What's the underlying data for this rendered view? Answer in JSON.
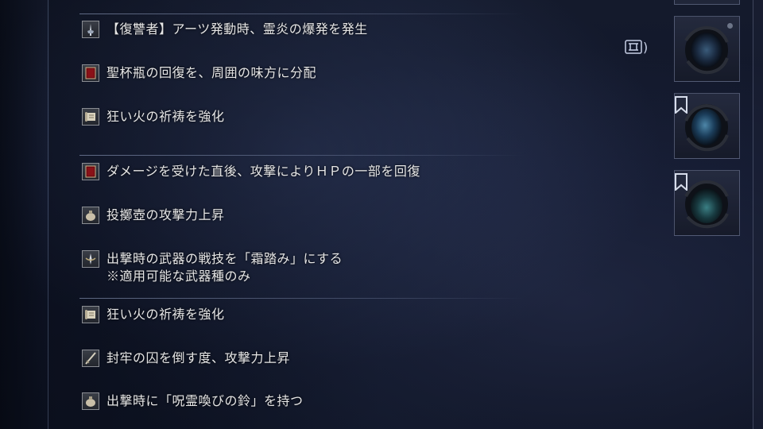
{
  "effects": [
    {
      "icon": "art-sword-icon",
      "text": "【復讐者】アーツ発動時、霊炎の爆発を発生"
    },
    {
      "icon": "red-tome-icon",
      "text": "聖杯瓶の回復を、周囲の味方に分配"
    },
    {
      "icon": "scroll-icon",
      "text": "狂い火の祈祷を強化"
    },
    {
      "icon": "red-tome-icon",
      "text": "ダメージを受けた直後、攻撃によりＨＰの一部を回復"
    },
    {
      "icon": "pot-icon",
      "text": "投擲壺の攻撃力上昇"
    },
    {
      "icon": "weapon-skill-icon",
      "text": "出撃時の武器の戦技を「霜踏み」にする",
      "subtext": "※適用可能な武器種のみ"
    },
    {
      "icon": "scroll-icon",
      "text": "狂い火の祈祷を強化"
    },
    {
      "icon": "blade-icon",
      "text": "封牢の囚を倒す度、攻撃力上昇"
    },
    {
      "icon": "pot-icon",
      "text": "出撃時に「呪霊喚びの鈴」を持つ"
    }
  ],
  "hint": {
    "key_icon": "r-stick-icon",
    "label": ")"
  },
  "relic_slots": [
    {
      "name": "relic-slot-1",
      "bookmarked": false
    },
    {
      "name": "relic-slot-2",
      "bookmarked": true
    },
    {
      "name": "relic-slot-3",
      "bookmarked": true
    }
  ]
}
